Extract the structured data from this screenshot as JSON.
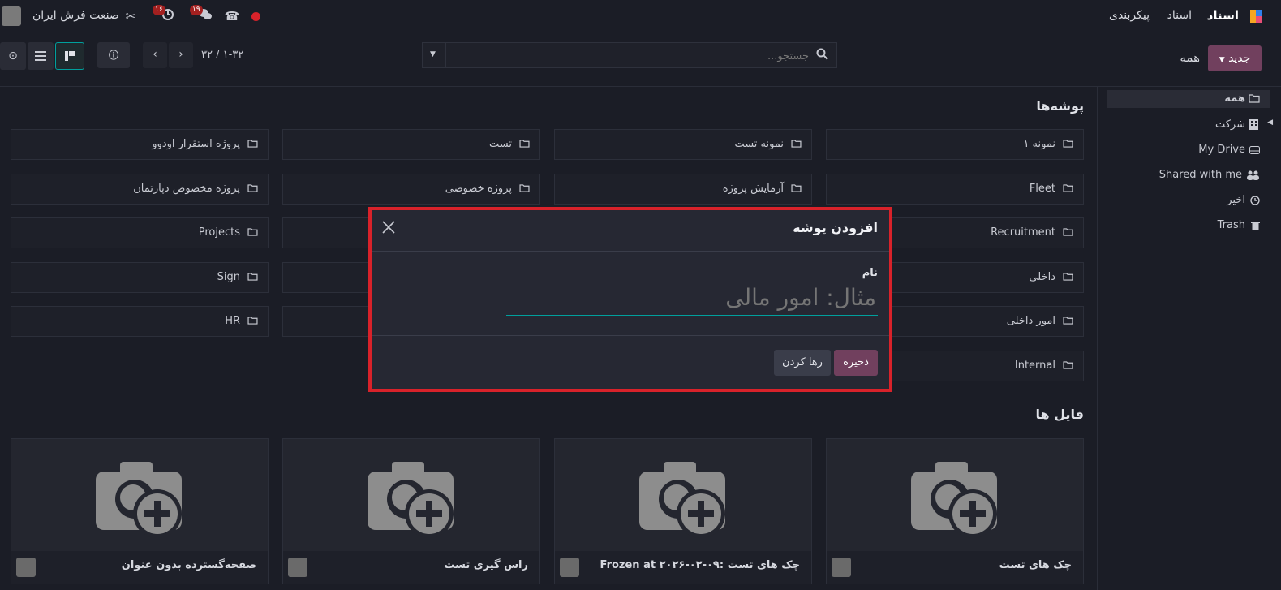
{
  "topbar": {
    "brand": "اسناد",
    "menu": [
      "اسناد",
      "پیکربندی"
    ],
    "company": "صنعت فرش ایران",
    "activity_badge": "۱۶",
    "messages_badge": "۱۹"
  },
  "controlbar": {
    "new_button": "جدید",
    "breadcrumb": "همه",
    "search_placeholder": "جستجو...",
    "pager": "۳۲ / ۱-۳۲"
  },
  "sidebar": {
    "items": [
      {
        "label": "همه",
        "icon": "folder-icon"
      },
      {
        "label": "شرکت",
        "icon": "building-icon"
      },
      {
        "label": "My Drive",
        "icon": "drive-icon"
      },
      {
        "label": "Shared with me",
        "icon": "users-icon"
      },
      {
        "label": "اخیر",
        "icon": "clock-icon"
      },
      {
        "label": "Trash",
        "icon": "trash-icon"
      }
    ]
  },
  "main": {
    "folders_title": "پوشه‌ها",
    "files_title": "فایل ها",
    "folders": [
      [
        "نمونه ۱",
        "نمونه تست",
        "تست",
        "پروژه استقرار اودوو"
      ],
      [
        "Fleet",
        "آزمایش پروژه",
        "پروژه خصوصی",
        "پروژه مخصوص دپارتمان"
      ],
      [
        "Recruitment",
        "",
        "",
        "Projects"
      ],
      [
        "داخلی",
        "",
        "",
        "Sign"
      ],
      [
        "امور داخلی",
        "",
        "",
        "HR"
      ],
      [
        "Internal"
      ]
    ],
    "files": [
      "چک های تست",
      "Frozen at ۲۰۲۶-۰۲-۰۹: چک های تست",
      "راس گیری تست",
      "صفحه‌گسترده بدون عنوان"
    ]
  },
  "dialog": {
    "title": "افزودن پوشه",
    "name_label": "نام",
    "name_placeholder": "مثال: امور مالی",
    "save_button": "ذخیره",
    "discard_button": "رها کردن"
  },
  "colors": {
    "accent": "#71405e",
    "focus": "#00a09d",
    "highlight": "#d8222a"
  }
}
